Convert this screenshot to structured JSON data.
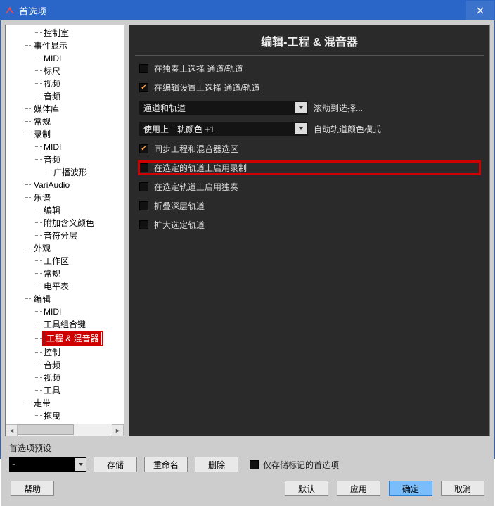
{
  "window": {
    "title": "首选项"
  },
  "tree": {
    "items": [
      {
        "label": "控制室",
        "indent": 3
      },
      {
        "label": "事件显示",
        "indent": 2
      },
      {
        "label": "MIDI",
        "indent": 3
      },
      {
        "label": "标尺",
        "indent": 3
      },
      {
        "label": "视频",
        "indent": 3
      },
      {
        "label": "音频",
        "indent": 3
      },
      {
        "label": "媒体库",
        "indent": 2
      },
      {
        "label": "常规",
        "indent": 2
      },
      {
        "label": "录制",
        "indent": 2
      },
      {
        "label": "MIDI",
        "indent": 3
      },
      {
        "label": "音频",
        "indent": 3
      },
      {
        "label": "广播波形",
        "indent": 4
      },
      {
        "label": "VariAudio",
        "indent": 2
      },
      {
        "label": "乐谱",
        "indent": 2
      },
      {
        "label": "编辑",
        "indent": 3
      },
      {
        "label": "附加含义颜色",
        "indent": 3
      },
      {
        "label": "音符分层",
        "indent": 3
      },
      {
        "label": "外观",
        "indent": 2
      },
      {
        "label": "工作区",
        "indent": 3
      },
      {
        "label": "常规",
        "indent": 3
      },
      {
        "label": "电平表",
        "indent": 3
      },
      {
        "label": "编辑",
        "indent": 2
      },
      {
        "label": "MIDI",
        "indent": 3
      },
      {
        "label": "工具组合键",
        "indent": 3
      },
      {
        "label": "工程 & 混音器",
        "indent": 3,
        "selected": true,
        "boxed": true
      },
      {
        "label": "控制",
        "indent": 3
      },
      {
        "label": "音频",
        "indent": 3
      },
      {
        "label": "视频",
        "indent": 3
      },
      {
        "label": "工具",
        "indent": 3
      },
      {
        "label": "走带",
        "indent": 2
      },
      {
        "label": "拖曳",
        "indent": 3
      }
    ]
  },
  "panel": {
    "title": "编辑-工程 & 混音器",
    "opts": {
      "a": "在独奏上选择 通道/轨道",
      "b": "在编辑设置上选择 通道/轨道",
      "sel1_value": "通道和轨道",
      "sel1_after": "滚动到选择...",
      "sel2_value": "使用上一轨颜色 +1",
      "sel2_after": "自动轨道颜色模式",
      "c": "同步工程和混音器选区",
      "d": "在选定的轨道上启用录制",
      "e": "在选定轨道上启用独奏",
      "f": "折叠深层轨道",
      "g": "扩大选定轨道"
    }
  },
  "preset": {
    "label": "首选项预设",
    "value": "-",
    "store": "存储",
    "rename": "重命名",
    "delete": "删除",
    "only_marked": "仅存储标记的首选项"
  },
  "footer": {
    "help": "帮助",
    "default": "默认",
    "apply": "应用",
    "ok": "确定",
    "cancel": "取消"
  }
}
